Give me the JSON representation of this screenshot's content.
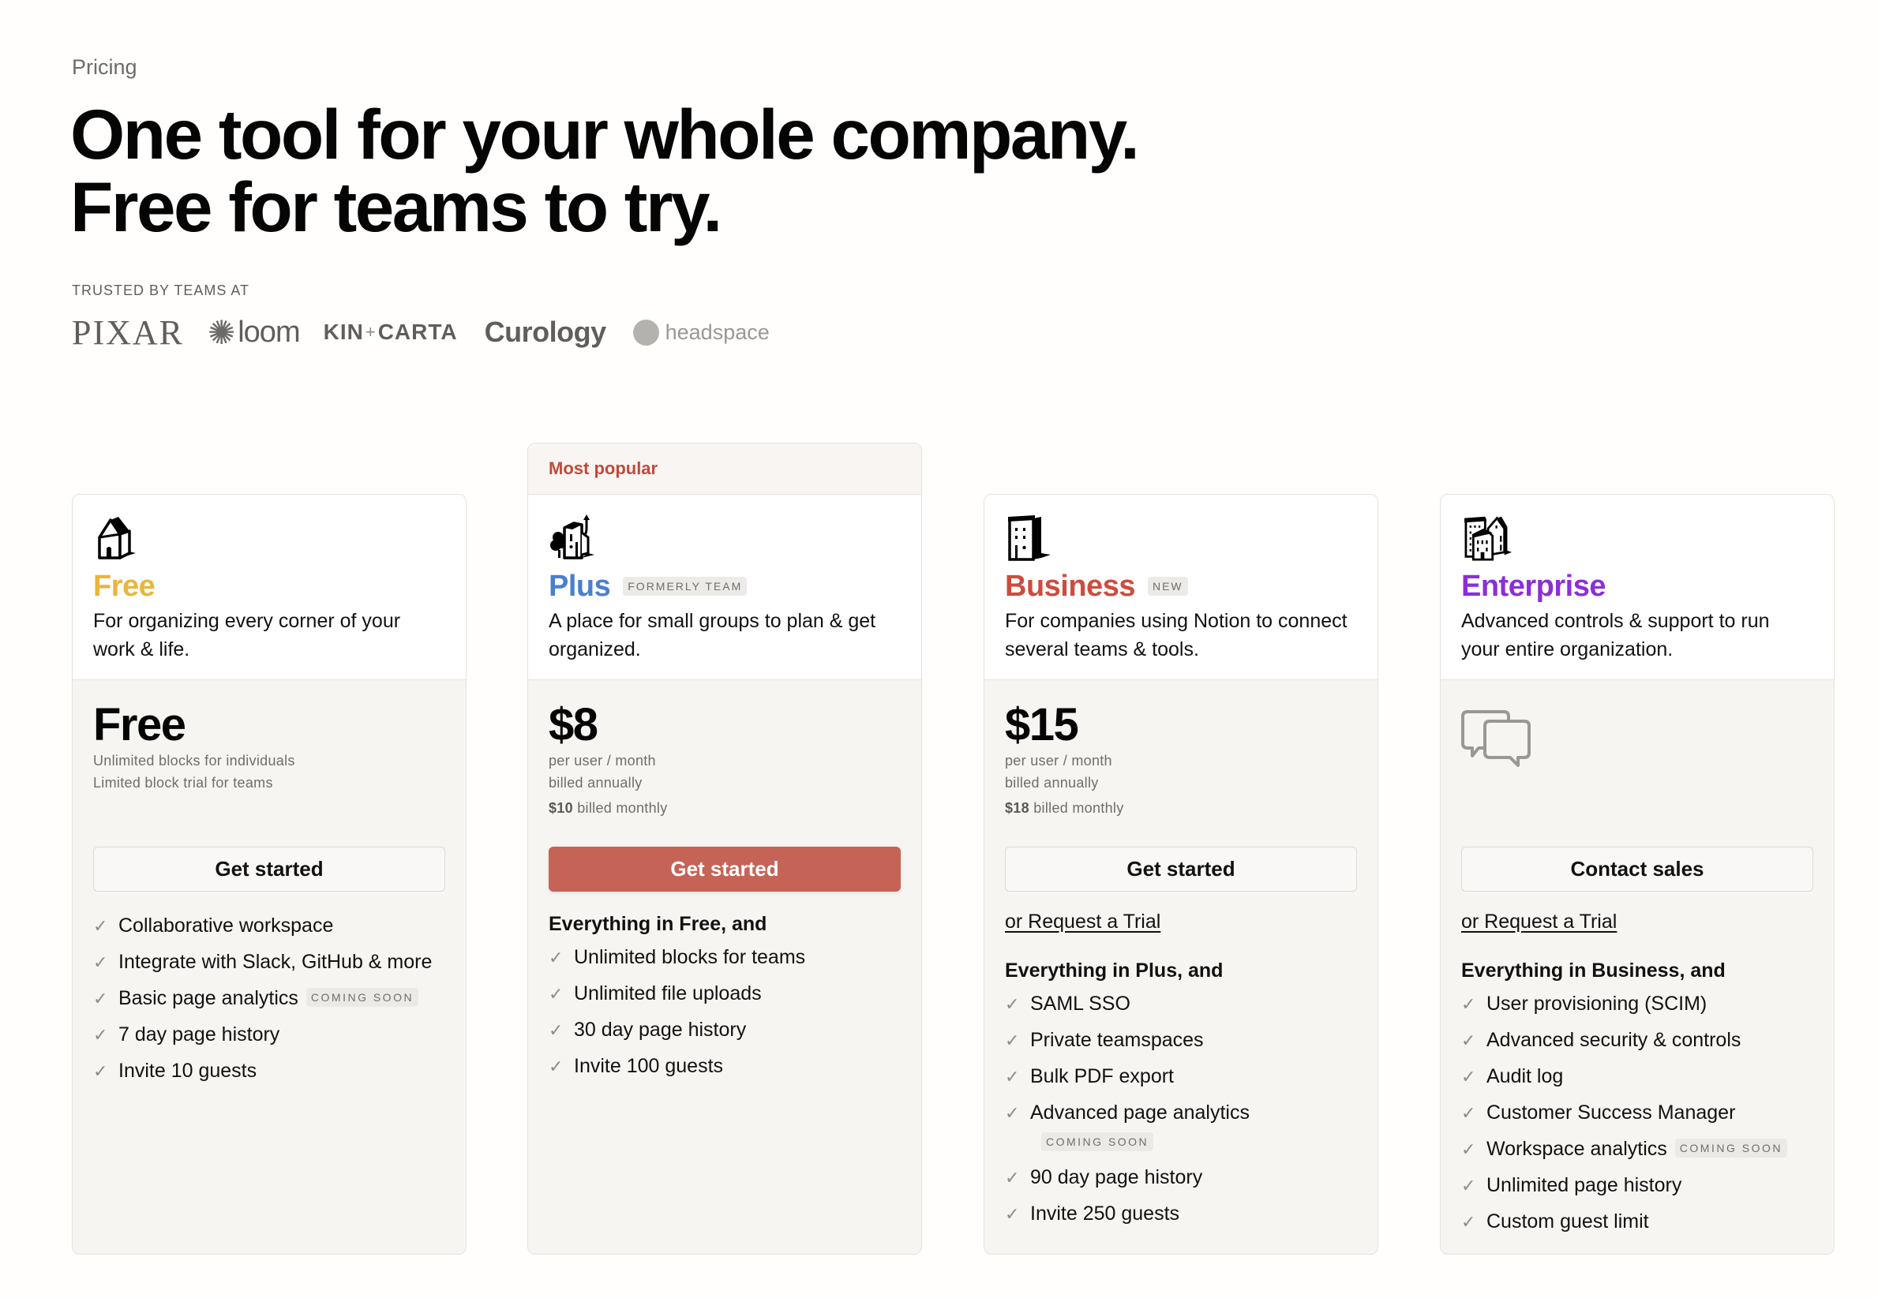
{
  "header": {
    "eyebrow": "Pricing",
    "headline_line1": "One tool for your whole company.",
    "headline_line2": "Free for teams to try.",
    "trusted_label": "TRUSTED BY TEAMS AT",
    "logos": {
      "pixar": "PIXAR",
      "loom": "loom",
      "kin": "KIN",
      "kin_plus": "+",
      "carta": "CARTA",
      "curology": "Curology",
      "headspace": "headspace"
    }
  },
  "colors": {
    "free": "#e9b53c",
    "plus": "#4a7fcf",
    "business": "#cd4c3f",
    "enterprise": "#8b2fd8",
    "primary_button": "#c66357",
    "popular_label": "#c2493a"
  },
  "plans": [
    {
      "name": "Free",
      "icon": "house-icon",
      "description": "For organizing every corner of your work & life.",
      "price": "Free",
      "price_lines": [
        "Unlimited blocks for individuals",
        "Limited block trial for teams"
      ],
      "button": "Get started",
      "features_heading": "",
      "features": [
        {
          "text": "Collaborative workspace"
        },
        {
          "text": "Integrate with Slack, GitHub & more"
        },
        {
          "text": "Basic page analytics",
          "badge": "COMING SOON"
        },
        {
          "text": "7 day page history"
        },
        {
          "text": "Invite 10 guests"
        }
      ]
    },
    {
      "name": "Plus",
      "badge": "FORMERLY TEAM",
      "popular_label": "Most popular",
      "icon": "building-with-tree-icon",
      "description": "A place for small groups to plan & get organized.",
      "price": "$8",
      "price_lines": [
        "per user / month",
        "billed annually"
      ],
      "monthly_amount": "$10",
      "monthly_text": " billed monthly",
      "button": "Get started",
      "features_heading": "Everything in Free, and",
      "features": [
        {
          "text": "Unlimited blocks for teams"
        },
        {
          "text": "Unlimited file uploads"
        },
        {
          "text": "30 day page history"
        },
        {
          "text": "Invite 100 guests"
        }
      ]
    },
    {
      "name": "Business",
      "badge": "NEW",
      "icon": "office-building-icon",
      "description": "For companies using Notion to connect several teams & tools.",
      "price": "$15",
      "price_lines": [
        "per user / month",
        "billed annually"
      ],
      "monthly_amount": "$18",
      "monthly_text": " billed monthly",
      "button": "Get started",
      "trial_link": "or Request a Trial",
      "features_heading": "Everything in Plus, and",
      "features": [
        {
          "text": "SAML SSO"
        },
        {
          "text": "Private teamspaces"
        },
        {
          "text": "Bulk PDF export"
        },
        {
          "text": "Advanced page analytics",
          "badge": "COMING SOON"
        },
        {
          "text": "90 day page history"
        },
        {
          "text": "Invite 250 guests"
        }
      ]
    },
    {
      "name": "Enterprise",
      "icon": "city-buildings-icon",
      "description": "Advanced controls & support to run your entire organization.",
      "price_icon": "chat-bubbles-icon",
      "button": "Contact sales",
      "trial_link": "or Request a Trial",
      "features_heading": "Everything in Business, and",
      "features": [
        {
          "text": "User provisioning (SCIM)"
        },
        {
          "text": "Advanced security & controls"
        },
        {
          "text": "Audit log"
        },
        {
          "text": "Customer Success Manager"
        },
        {
          "text": "Workspace analytics",
          "badge": "COMING SOON"
        },
        {
          "text": "Unlimited page history"
        },
        {
          "text": "Custom guest limit"
        }
      ]
    }
  ]
}
